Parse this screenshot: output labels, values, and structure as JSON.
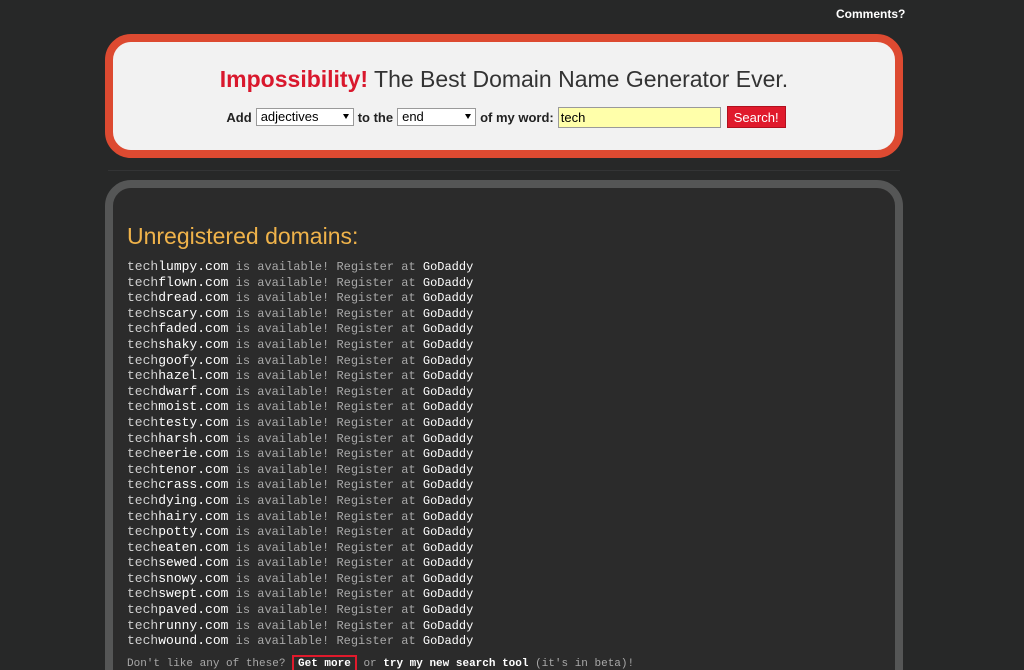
{
  "top_nav": {
    "comments_label": "Comments?"
  },
  "header": {
    "brand": "Impossibility!",
    "tagline": " The Best Domain Name Generator Ever."
  },
  "search": {
    "add_label": "Add",
    "category_selected": "adjectives",
    "to_the_label": "to the",
    "position_selected": "end",
    "of_my_word_label": "of my word:",
    "word_value": "tech",
    "button_label": "Search!"
  },
  "results": {
    "title": "Unregistered domains:",
    "available_text": " is available! Register at ",
    "registrar": "GoDaddy",
    "domains": [
      {
        "prefix": "tech",
        "suffix": "lumpy.com"
      },
      {
        "prefix": "tech",
        "suffix": "flown.com"
      },
      {
        "prefix": "tech",
        "suffix": "dread.com"
      },
      {
        "prefix": "tech",
        "suffix": "scary.com"
      },
      {
        "prefix": "tech",
        "suffix": "faded.com"
      },
      {
        "prefix": "tech",
        "suffix": "shaky.com"
      },
      {
        "prefix": "tech",
        "suffix": "goofy.com"
      },
      {
        "prefix": "tech",
        "suffix": "hazel.com"
      },
      {
        "prefix": "tech",
        "suffix": "dwarf.com"
      },
      {
        "prefix": "tech",
        "suffix": "moist.com"
      },
      {
        "prefix": "tech",
        "suffix": "testy.com"
      },
      {
        "prefix": "tech",
        "suffix": "harsh.com"
      },
      {
        "prefix": "tech",
        "suffix": "eerie.com"
      },
      {
        "prefix": "tech",
        "suffix": "tenor.com"
      },
      {
        "prefix": "tech",
        "suffix": "crass.com"
      },
      {
        "prefix": "tech",
        "suffix": "dying.com"
      },
      {
        "prefix": "tech",
        "suffix": "hairy.com"
      },
      {
        "prefix": "tech",
        "suffix": "potty.com"
      },
      {
        "prefix": "tech",
        "suffix": "eaten.com"
      },
      {
        "prefix": "tech",
        "suffix": "sewed.com"
      },
      {
        "prefix": "tech",
        "suffix": "snowy.com"
      },
      {
        "prefix": "tech",
        "suffix": "swept.com"
      },
      {
        "prefix": "tech",
        "suffix": "paved.com"
      },
      {
        "prefix": "tech",
        "suffix": "runny.com"
      },
      {
        "prefix": "tech",
        "suffix": "wound.com"
      }
    ]
  },
  "footer": {
    "question": "Don't like any of these? ",
    "get_more_label": "Get more",
    "or_text": " or ",
    "try_label": "try my new search tool",
    "beta_text": " (it's in beta)!"
  },
  "colors": {
    "background": "#272828",
    "header_border": "#dd4a31",
    "brand_red": "#d9182d",
    "results_title": "#f0b34a",
    "results_border": "#555656",
    "input_bg": "#ffffaa",
    "button_red": "#e01a2c"
  }
}
